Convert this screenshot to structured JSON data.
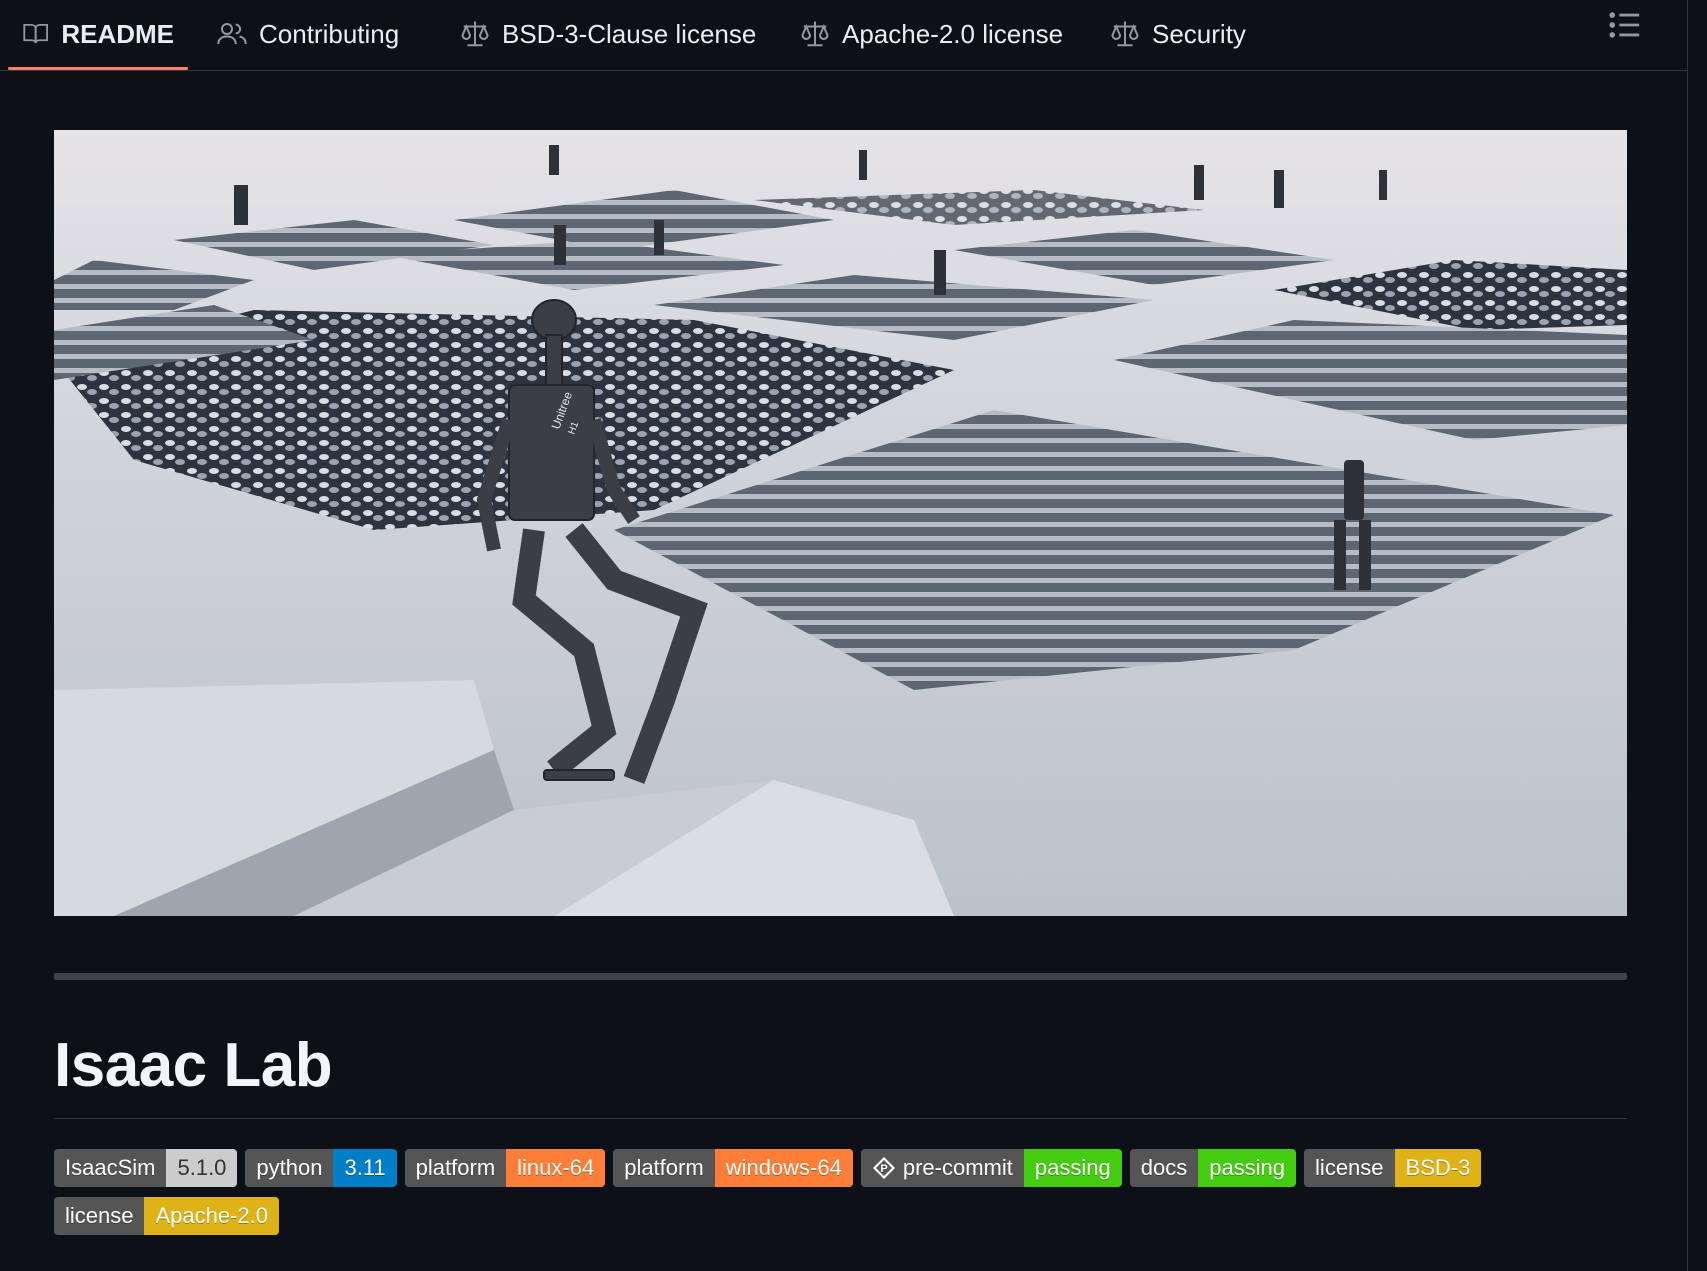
{
  "tabs": [
    {
      "label": "README",
      "icon": "book-icon",
      "active": true
    },
    {
      "label": "Contributing",
      "icon": "people-icon"
    },
    {
      "label": "BSD-3-Clause license",
      "icon": "law-icon"
    },
    {
      "label": "Apache-2.0 license",
      "icon": "law-icon"
    },
    {
      "label": "Security",
      "icon": "law-icon"
    }
  ],
  "hero": {
    "robot_label": "Unitree",
    "robot_model": "H1"
  },
  "title": "Isaac Lab",
  "badges": [
    {
      "label": "IsaacSim",
      "value": "5.1.0",
      "color": "#cccccc",
      "value_text_color": "#333333"
    },
    {
      "label": "python",
      "value": "3.11",
      "color": "#007ec6"
    },
    {
      "label": "platform",
      "value": "linux-64",
      "color": "#fe7d37"
    },
    {
      "label": "platform",
      "value": "windows-64",
      "color": "#fe7d37"
    },
    {
      "label": "pre-commit",
      "value": "passing",
      "color": "#4c1",
      "icon": "pre-commit-icon"
    },
    {
      "label": "docs",
      "value": "passing",
      "color": "#4c1"
    },
    {
      "label": "license",
      "value": "BSD-3",
      "color": "#dfb317"
    },
    {
      "label": "license",
      "value": "Apache-2.0",
      "color": "#dfb317"
    }
  ],
  "colors": {
    "background": "#0d1117",
    "active_tab_underline": "#f78166",
    "border": "#30363d"
  }
}
